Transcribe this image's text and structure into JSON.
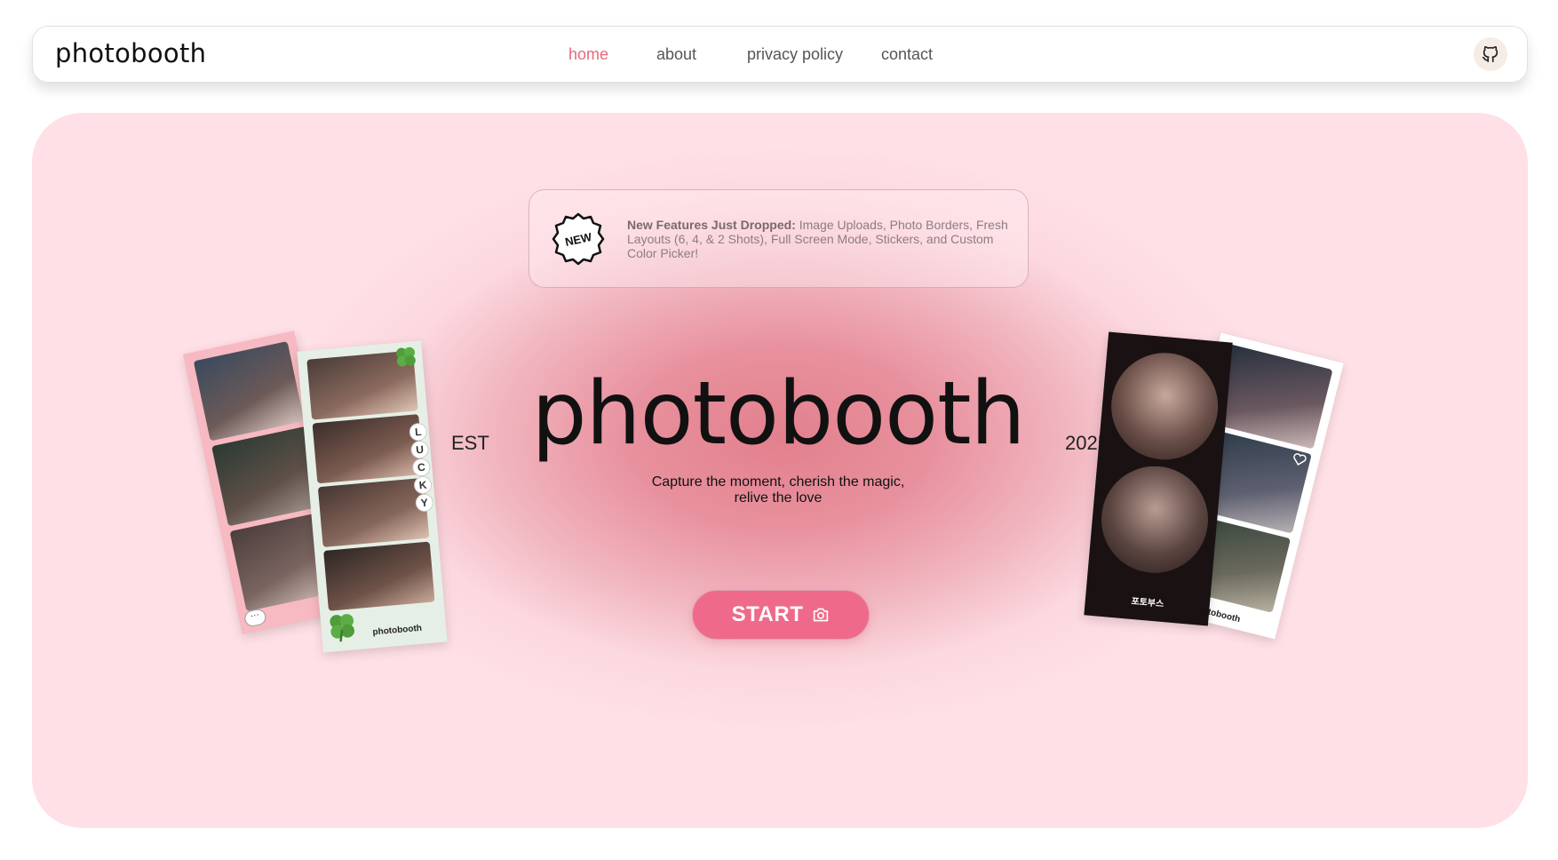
{
  "nav": {
    "brand": "photobooth",
    "links": [
      {
        "label": "home",
        "active": true
      },
      {
        "label": "about",
        "active": false
      },
      {
        "label": "privacy policy",
        "active": false
      },
      {
        "label": "contact",
        "active": false
      }
    ],
    "github_icon": "github-icon"
  },
  "announcement": {
    "badge": "NEW",
    "bold": "New Features Just Dropped:",
    "text": " Image Uploads, Photo Borders, Fresh Layouts (6, 4, & 2 Shots), Full Screen Mode, Stickers, and Custom Color Picker!"
  },
  "hero": {
    "est": "EST",
    "title": "photobooth",
    "year": "2025",
    "tagline": "Capture the moment, cherish the magic, relive the love",
    "start_label": "START",
    "start_icon": "camera-icon"
  },
  "strips": {
    "left_label": "photobooth",
    "lucky_letters": [
      "L",
      "U",
      "C",
      "K",
      "Y"
    ],
    "right_black_label": "포토부스",
    "right_white_label": "photobooth"
  },
  "colors": {
    "accent": "#ef6a8a",
    "active_link": "#e66a7a",
    "hero_bg": "#ffe0e6",
    "hero_center": "#e3808e"
  }
}
